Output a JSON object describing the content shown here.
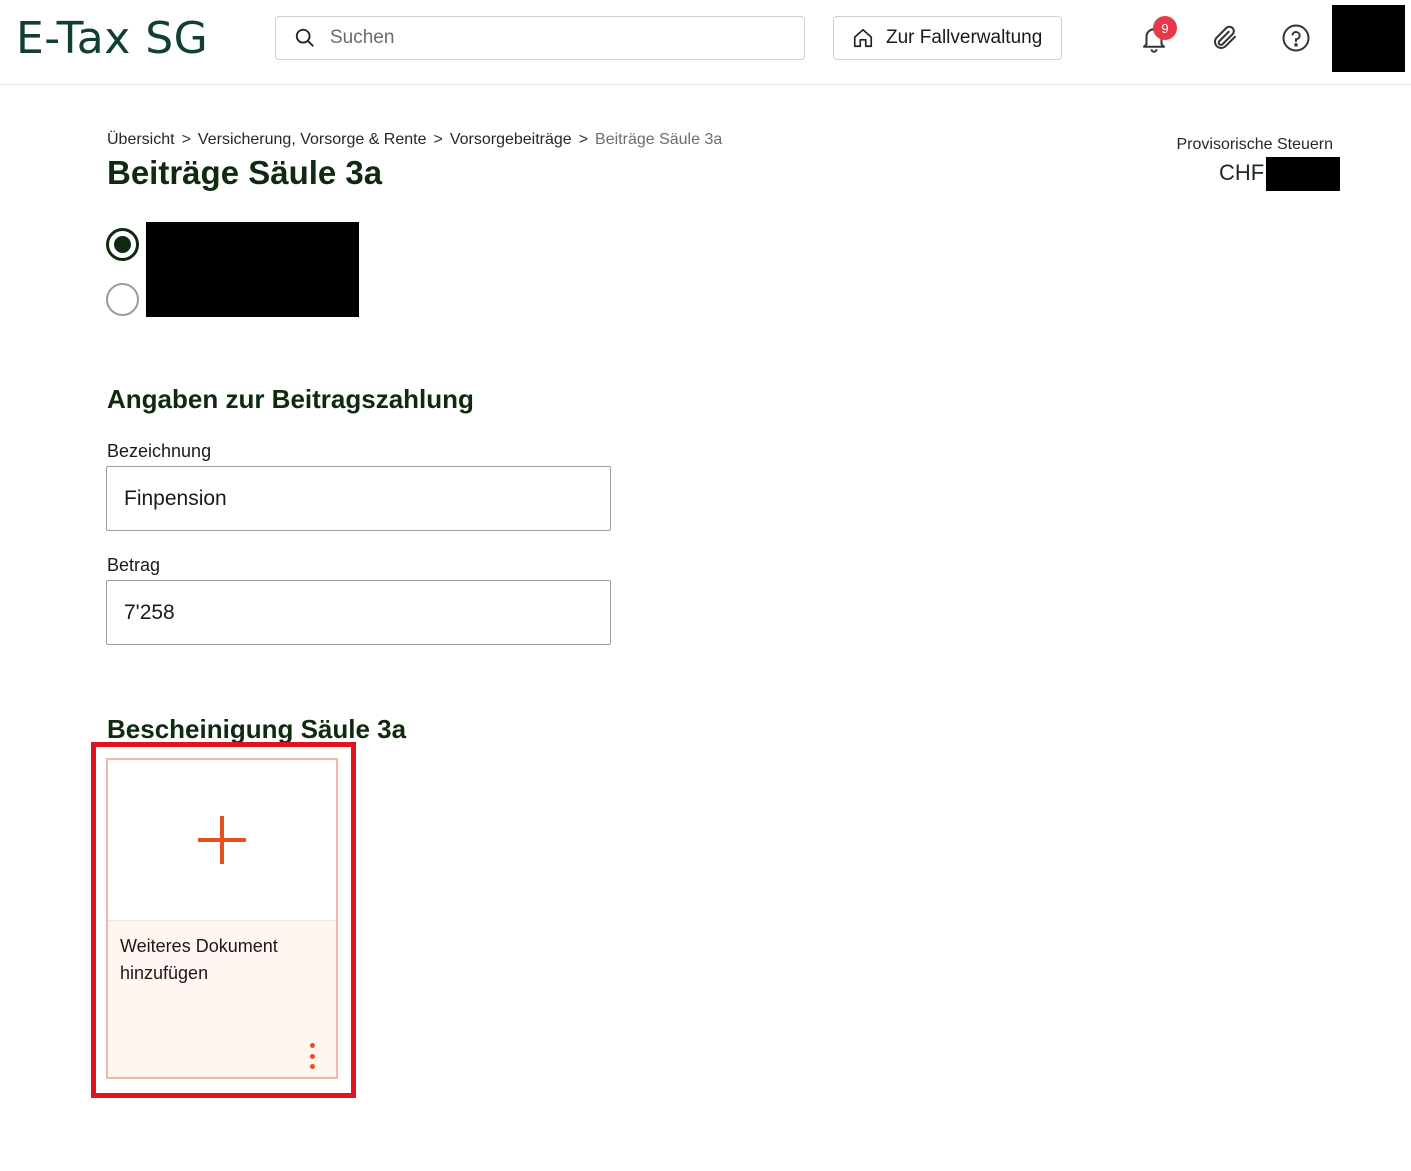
{
  "header": {
    "logo": "E-Tax SG",
    "search_placeholder": "Suchen",
    "case_button_label": "Zur Fallverwaltung",
    "notification_count": "9",
    "icons": [
      "search-icon",
      "home-icon",
      "bell-icon",
      "paperclip-icon",
      "help-icon"
    ]
  },
  "breadcrumb": {
    "items": [
      "Übersicht",
      "Versicherung, Vorsorge & Rente",
      "Vorsorgebeiträge"
    ],
    "separator": ">",
    "current": "Beiträge Säule 3a"
  },
  "page": {
    "title": "Beiträge Säule 3a"
  },
  "tax_summary": {
    "label": "Provisorische Steuern",
    "currency": "CHF"
  },
  "payment_section": {
    "title": "Angaben zur Beitragszahlung",
    "designation_label": "Bezeichnung",
    "designation_value": "Finpension",
    "amount_label": "Betrag",
    "amount_value": "7'258"
  },
  "certificate_section": {
    "title": "Bescheinigung Säule 3a",
    "add_document_label": "Weiteres Dokument hinzufügen"
  },
  "colors": {
    "brand_green": "#12402e",
    "title_green": "#0f2a0f",
    "accent_orange": "#e8501e",
    "badge_red": "#e6394b",
    "highlight_red": "#e0141e"
  }
}
